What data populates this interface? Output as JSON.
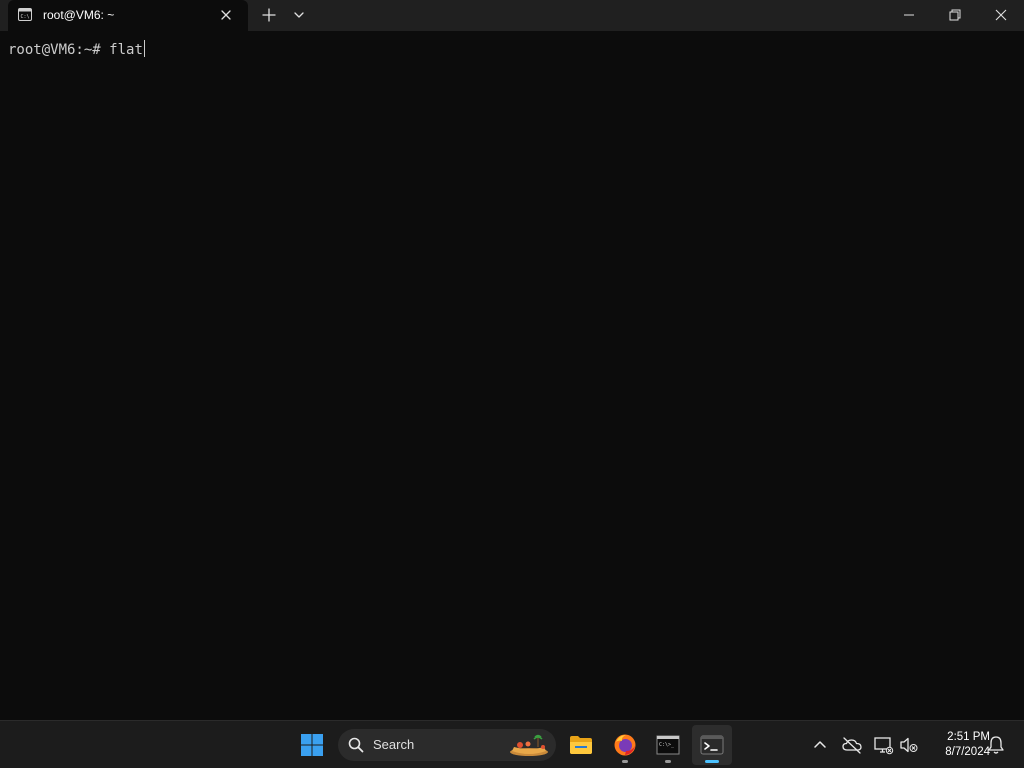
{
  "window": {
    "tab_title": "root@VM6: ~",
    "icons": {
      "tab": "terminal-tab-icon",
      "close_tab": "close-icon",
      "new_tab": "plus-icon",
      "dropdown": "chevron-down-icon",
      "minimize": "minimize-icon",
      "maximize": "restore-icon",
      "close": "close-icon"
    }
  },
  "terminal": {
    "prompt": "root@VM6:~#",
    "command": "flat"
  },
  "taskbar": {
    "search_label": "Search",
    "apps": [
      {
        "name": "start-button",
        "icon": "windows-logo-icon"
      },
      {
        "name": "file-explorer",
        "icon": "folder-icon"
      },
      {
        "name": "firefox",
        "icon": "firefox-icon"
      },
      {
        "name": "command-prompt",
        "icon": "cmd-icon"
      },
      {
        "name": "windows-terminal",
        "icon": "terminal-icon"
      }
    ],
    "tray": {
      "icons": [
        "chevron-up-icon",
        "cloud-off-icon",
        "network-icon",
        "volume-muted-icon",
        "notification-bell-icon"
      ]
    },
    "clock": {
      "time": "2:51 PM",
      "date": "8/7/2024"
    }
  },
  "colors": {
    "terminal_bg": "#0c0c0c",
    "titlebar_bg": "#202020",
    "taskbar_bg": "#1c1c1c",
    "accent": "#4cc2ff"
  }
}
